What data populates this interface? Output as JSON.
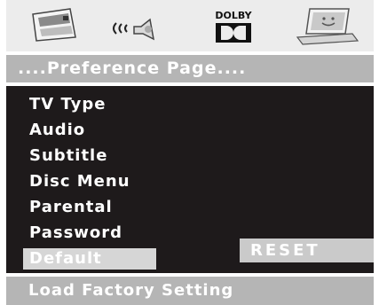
{
  "tabs": [
    {
      "icon": "general-setup-icon"
    },
    {
      "icon": "audio-setup-icon"
    },
    {
      "icon": "dolby-setup-icon",
      "label": "DOLBY"
    },
    {
      "icon": "preference-setup-icon",
      "selected": true
    }
  ],
  "title": "....Preference Page....",
  "menu": {
    "items": [
      {
        "label": "TV Type"
      },
      {
        "label": "Audio"
      },
      {
        "label": "Subtitle"
      },
      {
        "label": "Disc Menu"
      },
      {
        "label": "Parental"
      },
      {
        "label": "Password"
      },
      {
        "label": "Default",
        "selected": true
      }
    ]
  },
  "submenu": {
    "reset_label": "RESET"
  },
  "status": "Load Factory Setting",
  "colors": {
    "panel_bg": "#1e1a1b",
    "bar_bg": "#b5b5b5",
    "highlight_bg": "#d6d6d6",
    "tab_strip_bg": "#ececec",
    "text": "#ffffff"
  }
}
